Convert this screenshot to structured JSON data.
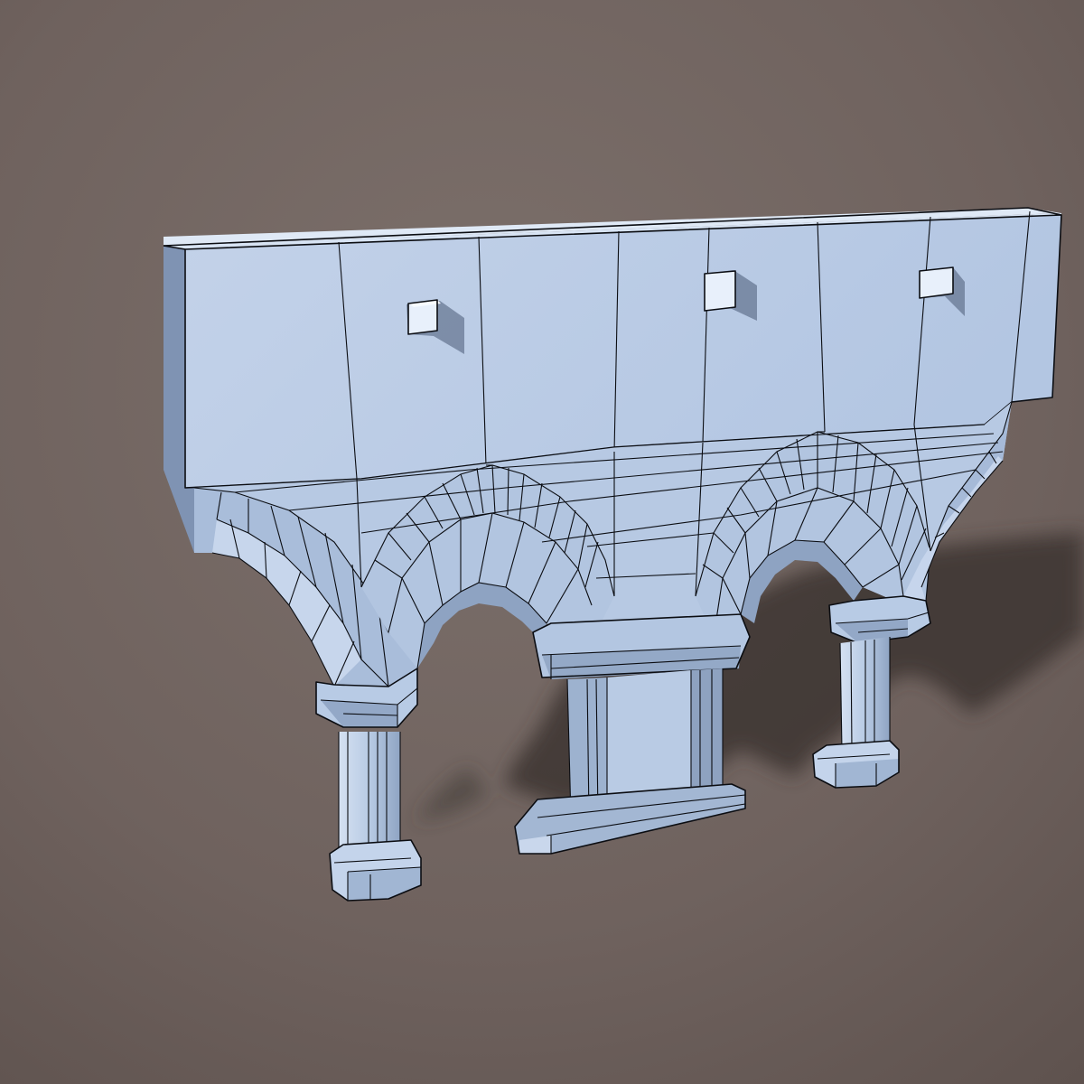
{
  "scene": {
    "model": "arcade-wall",
    "components": [
      "wall-top",
      "arch-left-half",
      "arch-center-left",
      "arch-center-right",
      "arch-right-half",
      "column-left",
      "pier-center",
      "column-right",
      "wall-blocks"
    ],
    "colors": {
      "background": "#6f625e",
      "mesh_face": "#bccde6",
      "mesh_face_light": "#d3e0f2",
      "mesh_face_dark": "#93a8c6",
      "wireframe": "#0b0d12",
      "shadow": "#3d3532"
    },
    "wall_block_count": 3
  }
}
